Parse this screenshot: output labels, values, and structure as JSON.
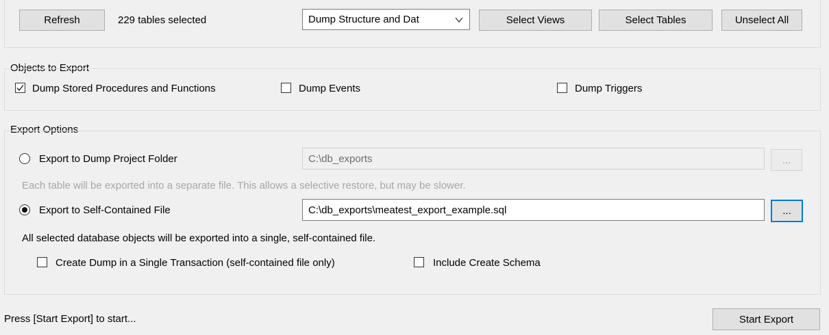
{
  "toolbar": {
    "refresh_label": "Refresh",
    "selection_status": "229 tables selected",
    "dump_mode": {
      "selected": "Dump Structure and Dat"
    },
    "select_views_label": "Select Views",
    "select_tables_label": "Select Tables",
    "unselect_all_label": "Unselect All"
  },
  "objects": {
    "group_label": "Objects to Export",
    "items": [
      {
        "label": "Dump Stored Procedures and Functions",
        "checked": true
      },
      {
        "label": "Dump Events",
        "checked": false
      },
      {
        "label": "Dump Triggers",
        "checked": false
      }
    ]
  },
  "export_options": {
    "group_label": "Export Options",
    "project_folder": {
      "label": "Export to Dump Project Folder",
      "path": "C:\\db_exports",
      "browse_label": "...",
      "selected": false,
      "hint": "Each table will be exported into a separate file. This allows a selective restore, but may be slower."
    },
    "self_contained": {
      "label": "Export to Self-Contained File",
      "path": "C:\\db_exports\\meatest_export_example.sql",
      "browse_label": "...",
      "selected": true,
      "hint": "All selected database objects will be exported into a single, self-contained file."
    },
    "options": [
      {
        "label": "Create Dump in a Single Transaction (self-contained file only)",
        "checked": false
      },
      {
        "label": "Include Create Schema",
        "checked": false
      }
    ]
  },
  "footer": {
    "status": "Press [Start Export] to start...",
    "start_label": "Start Export"
  }
}
